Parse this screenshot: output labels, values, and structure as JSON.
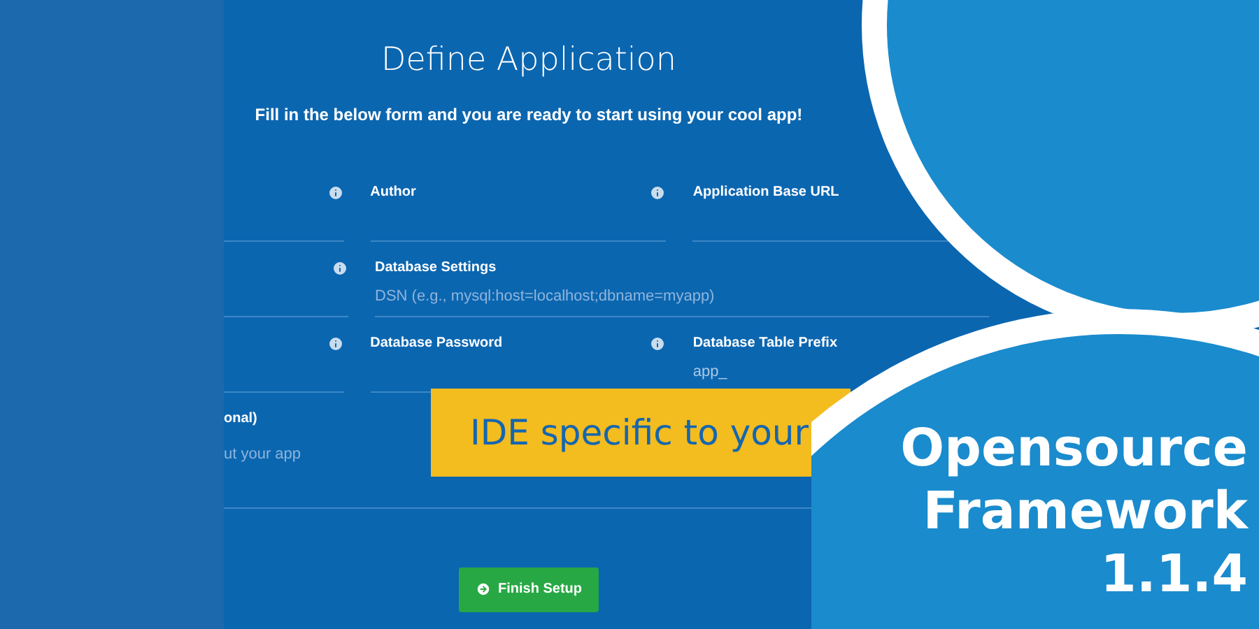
{
  "form": {
    "title": "Define Application",
    "subtitle": "Fill in the below form and you are ready to start using your cool app!",
    "rows": [
      [
        {
          "kind": "narrow",
          "info": true
        },
        {
          "kind": "normal",
          "label": "Author",
          "info": true
        },
        {
          "kind": "normal",
          "label": "Application Base URL"
        }
      ],
      [
        {
          "kind": "narrow",
          "info": true
        },
        {
          "kind": "wide",
          "label": "Database Settings",
          "placeholder": "DSN (e.g., mysql:host=localhost;dbname=myapp)"
        }
      ],
      [
        {
          "kind": "narrow",
          "info": true
        },
        {
          "kind": "normal",
          "label": "Database Password",
          "info": true
        },
        {
          "kind": "normal",
          "label": "Database Table Prefix",
          "value": "app_"
        }
      ],
      [
        {
          "kind": "full",
          "label": "onal)",
          "placeholder": "ut your app"
        }
      ]
    ],
    "button": "Finish Setup"
  },
  "banner": {
    "text": "IDE specific to your"
  },
  "headline": [
    "Opensource",
    "Framework",
    "1.1.4"
  ]
}
